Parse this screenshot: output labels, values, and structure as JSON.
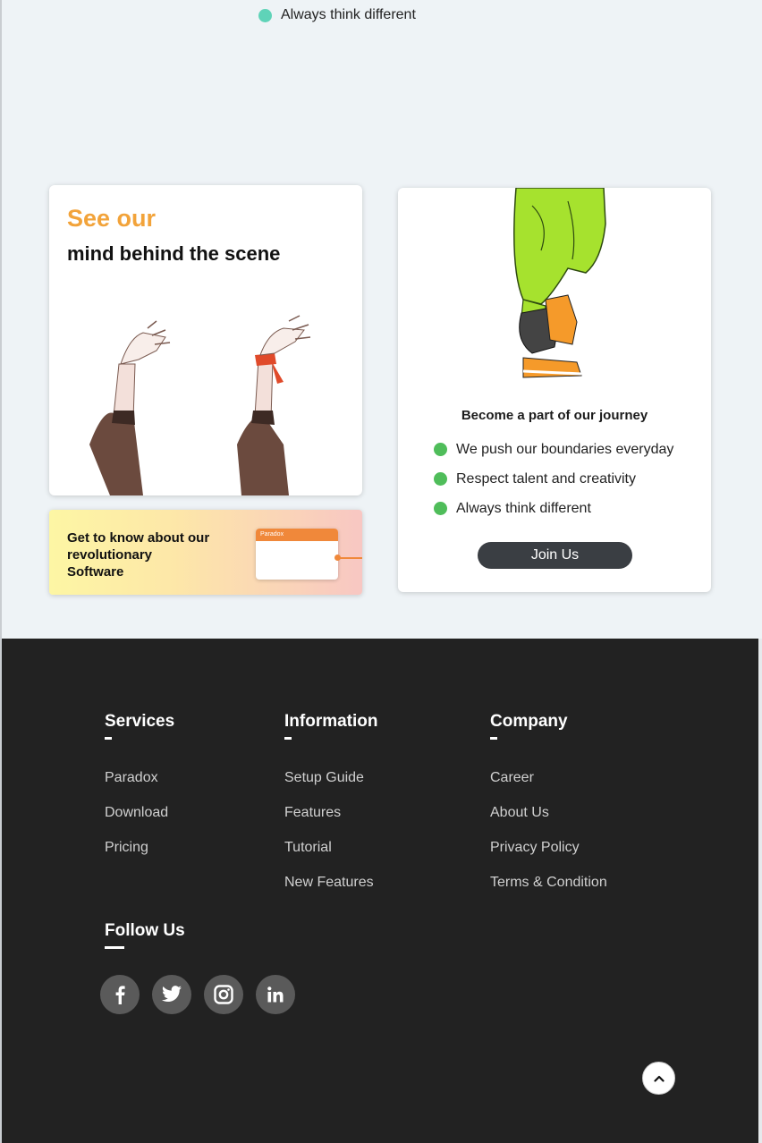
{
  "top_bullet": {
    "text": "Always think different"
  },
  "scene_card": {
    "title": "See our",
    "subtitle": "mind behind the scene"
  },
  "software_card": {
    "text": "Get to know about our revolutionary Software",
    "window_label": "Paradox"
  },
  "journey_card": {
    "title": "Become a part of our journey",
    "items": [
      "We push our boundaries everyday",
      "Respect talent and creativity",
      "Always think different"
    ],
    "button_label": "Join Us"
  },
  "footer": {
    "services": {
      "title": "Services",
      "links": [
        "Paradox",
        "Download",
        "Pricing"
      ]
    },
    "information": {
      "title": "Information",
      "links": [
        "Setup Guide",
        "Features",
        "Tutorial",
        "New Features"
      ]
    },
    "company": {
      "title": "Company",
      "links": [
        "Career",
        "About Us",
        "Privacy Policy",
        "Terms & Condition"
      ]
    },
    "follow": {
      "title": "Follow Us",
      "icons": [
        "facebook-icon",
        "twitter-icon",
        "instagram-icon",
        "linkedin-icon"
      ]
    }
  },
  "colors": {
    "accent_orange": "#f2a33a",
    "bullet_green": "#4fbd5a",
    "bullet_teal": "#5fd3b8",
    "footer_bg": "#222222",
    "button_dark": "#3a3e43"
  }
}
